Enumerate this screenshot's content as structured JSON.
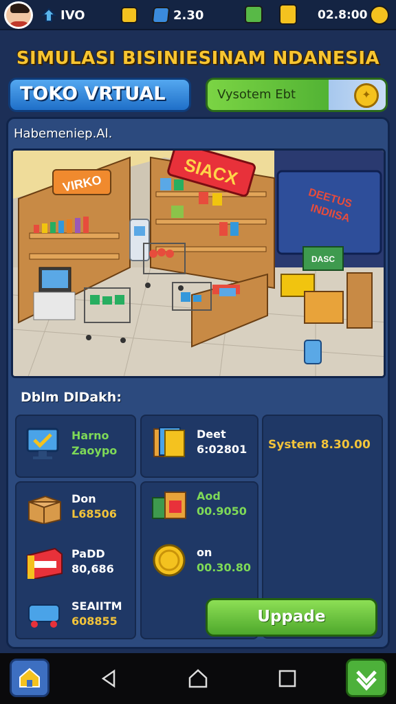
{
  "topbar": {
    "stats": [
      {
        "icon": "upgrade-arrow-icon",
        "value": "IVO"
      },
      {
        "icon": "gold-bar-icon",
        "value": ""
      },
      {
        "icon": "blue-gem-cube-icon",
        "value": "2.30"
      },
      {
        "icon": "green-box-icon",
        "value": ""
      },
      {
        "icon": "gold-coin-stack-icon",
        "value": "02.8:00"
      },
      {
        "icon": "gold-star-badge-icon",
        "value": ""
      }
    ]
  },
  "title": "SIMULASI BISINIESINAM NDANESIA",
  "toko_button": "TOKO VRTUAL",
  "system_pill": "Vysotem Ebt",
  "scene": {
    "label": "Habemeniep.Al.",
    "sign_main": "SIACX",
    "sign_left": "VIRKO",
    "sign_right_line1": "DEETUS",
    "sign_right_line2": "INDIISA",
    "small_sign": "DASC"
  },
  "items_label": "Dblm DlDakh:",
  "items": [
    {
      "icon": "monitor-check-icon",
      "name": "Harno",
      "value": "Zaoypo",
      "value_color": "green"
    },
    {
      "icon": "books-icon",
      "name": "Deet",
      "value": "6:02801",
      "value_color": "white"
    },
    {
      "icon": "cardboard-box-icon",
      "name": "Don",
      "value": "L68506",
      "value_color": "gold"
    },
    {
      "icon": "gift-boxes-icon",
      "name": "Aod",
      "value": "00.9050",
      "value_color": "green"
    },
    {
      "icon": "red-package-icon",
      "name": "PaDD",
      "value": "80,686",
      "value_color": "white"
    },
    {
      "icon": "gold-coin-icon",
      "name": "on",
      "value": "00.30.80",
      "value_color": "green"
    },
    {
      "icon": "blue-machine-icon",
      "name": "SEAIITM",
      "value": "608855",
      "value_color": "gold"
    }
  ],
  "system_value": "System 8.30.00",
  "upgrade_button": "Uppade",
  "colors": {
    "title": "#f7c531",
    "panel": "#2c4a7e",
    "card": "#1f3866",
    "accent_green": "#7ed957",
    "accent_gold": "#f3c43a",
    "primary_blue": "#2f86dd"
  }
}
